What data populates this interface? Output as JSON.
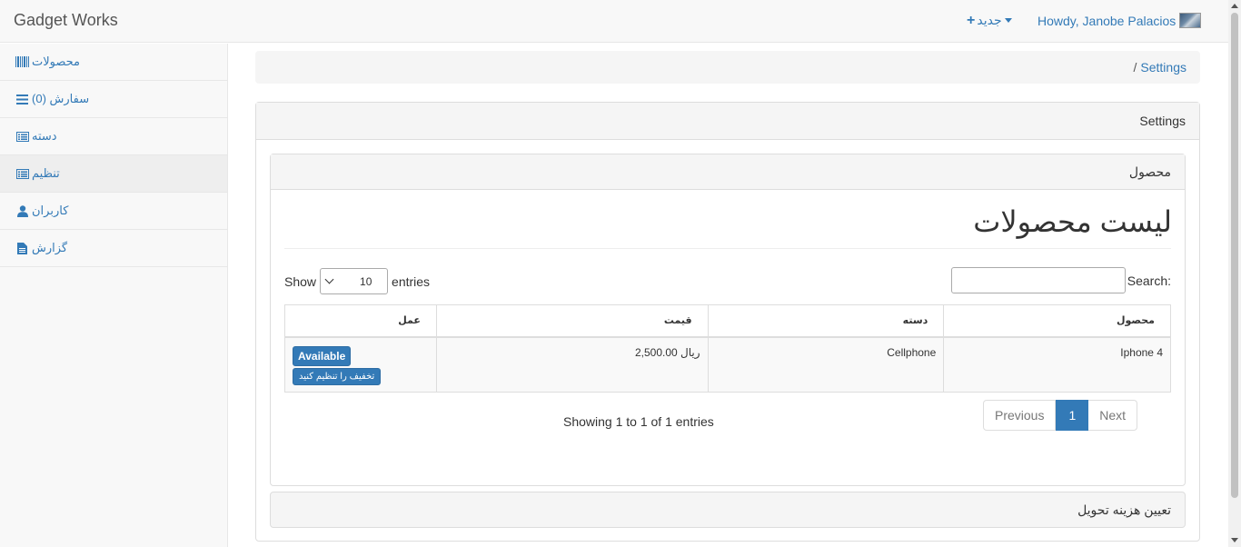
{
  "app": {
    "brand": "Gadget Works"
  },
  "header": {
    "new_label": "جدید",
    "howdy": "Howdy, Janobe Palacios"
  },
  "sidebar": {
    "items": [
      {
        "label": "محصولات",
        "icon": "barcode-icon"
      },
      {
        "label": "سفارش (0)",
        "icon": "list-icon"
      },
      {
        "label": "دسته",
        "icon": "table-list-icon"
      },
      {
        "label": "تنظیم",
        "icon": "table-list-icon"
      },
      {
        "label": "کاربران",
        "icon": "user-icon"
      },
      {
        "label": "گزارش",
        "icon": "file-icon"
      }
    ]
  },
  "breadcrumb": {
    "separator": "/",
    "current": "Settings"
  },
  "settings_panel": {
    "heading": "Settings"
  },
  "product_panel": {
    "heading": "محصول",
    "list_title": "لیست محصولات",
    "show_label": "Show",
    "entries_label": "entries",
    "page_length": "10",
    "search_label": "Search:",
    "search_value": "",
    "columns": [
      "محصول",
      "دسته",
      "قیمت",
      "عمل"
    ],
    "rows": [
      {
        "product": "Iphone 4",
        "category": "Cellphone",
        "price": "ریال 2,500.00",
        "status_button": "Available",
        "discount_button": "تخفیف را تنظیم کنید"
      }
    ],
    "info": "Showing 1 to 1 of 1 entries",
    "pagination": {
      "previous": "Previous",
      "current": "1",
      "next": "Next"
    }
  },
  "delivery_panel": {
    "heading": "تعیین هزینه تحویل"
  },
  "colors": {
    "link": "#337ab7",
    "panel_bg": "#f5f5f5"
  }
}
